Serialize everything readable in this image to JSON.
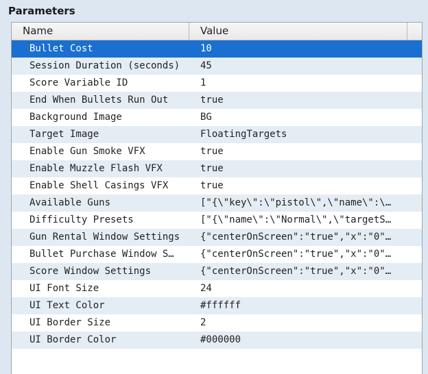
{
  "panel": {
    "title": "Parameters"
  },
  "table": {
    "columns": {
      "name": "Name",
      "value": "Value"
    },
    "selected_row": 0,
    "rows": [
      {
        "name": "Bullet Cost",
        "value": "10"
      },
      {
        "name": "Session Duration (seconds)",
        "value": "45"
      },
      {
        "name": "Score Variable ID",
        "value": "1"
      },
      {
        "name": "End When Bullets Run Out",
        "value": "true"
      },
      {
        "name": "Background Image",
        "value": "BG"
      },
      {
        "name": "Target Image",
        "value": "FloatingTargets"
      },
      {
        "name": "Enable Gun Smoke VFX",
        "value": "true"
      },
      {
        "name": "Enable Muzzle Flash VFX",
        "value": "true"
      },
      {
        "name": "Enable Shell Casings VFX",
        "value": "true"
      },
      {
        "name": "Available Guns",
        "value": "[\"{\\\"key\\\":\\\"pistol\\\",\\\"name\\\":\\…"
      },
      {
        "name": "Difficulty Presets",
        "value": "[\"{\\\"name\\\":\\\"Normal\\\",\\\"targetS…"
      },
      {
        "name": "Gun Rental Window Settings",
        "value": "{\"centerOnScreen\":\"true\",\"x\":\"0\"…"
      },
      {
        "name": "Bullet Purchase Window S…",
        "value": "{\"centerOnScreen\":\"true\",\"x\":\"0\"…"
      },
      {
        "name": "Score Window Settings",
        "value": "{\"centerOnScreen\":\"true\",\"x\":\"0\"…"
      },
      {
        "name": "UI Font Size",
        "value": "24"
      },
      {
        "name": "UI Text Color",
        "value": "#ffffff"
      },
      {
        "name": "UI Border Size",
        "value": "2"
      },
      {
        "name": "UI Border Color",
        "value": "#000000"
      }
    ]
  },
  "colors": {
    "selection": "#1a6fd0",
    "alt_row": "#e4ecf4",
    "background": "#dde7f1"
  }
}
